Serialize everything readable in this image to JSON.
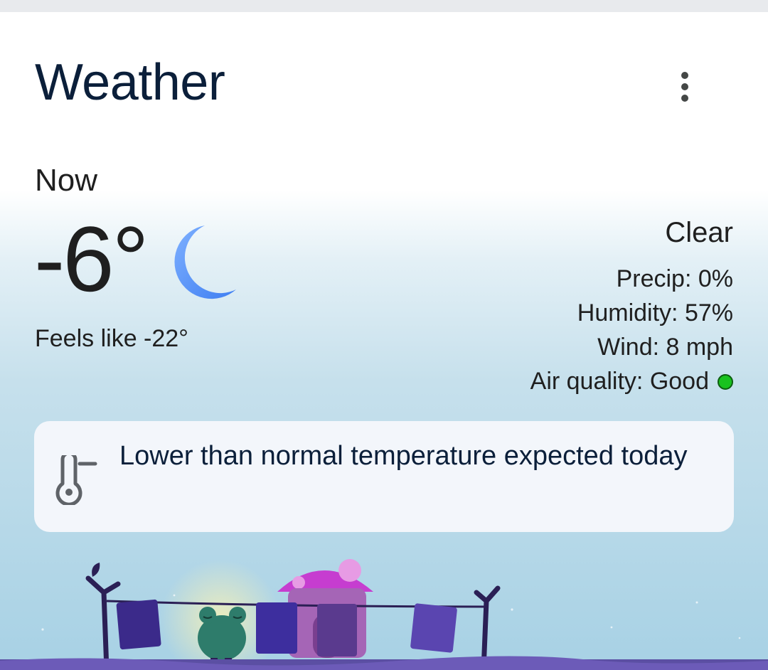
{
  "header": {
    "title": "Weather"
  },
  "current": {
    "label": "Now",
    "temperature": "-6°",
    "feels_like": "Feels like -22°",
    "condition": "Clear",
    "condition_icon": "crescent-moon-icon",
    "precip": "Precip: 0%",
    "humidity": "Humidity: 57%",
    "wind": "Wind: 8 mph",
    "air_quality": "Air quality: Good",
    "air_quality_color": "#19c21f"
  },
  "alert": {
    "icon": "thermometer-low-icon",
    "text": "Lower than normal temperature expected today"
  },
  "colors": {
    "title": "#0b1f3a",
    "moon": "#4f8ef7",
    "alert_bg": "#f3f6fb"
  }
}
